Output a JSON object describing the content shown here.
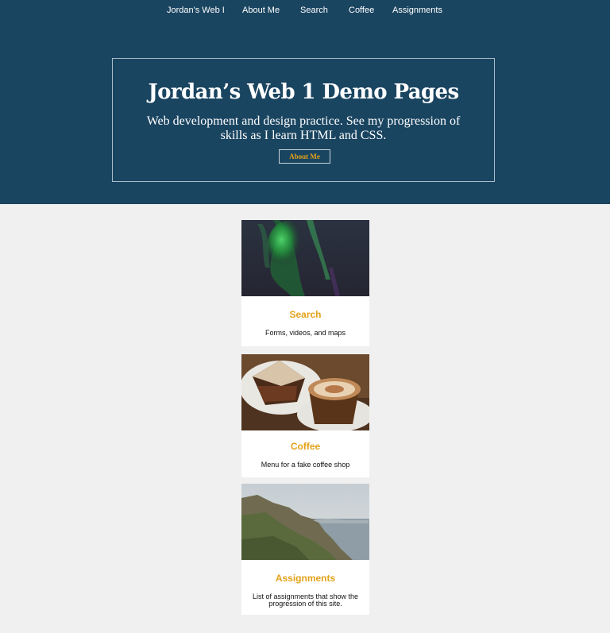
{
  "nav": {
    "items": [
      {
        "label": "Jordan's Web I"
      },
      {
        "label": "About Me"
      },
      {
        "label": "Search"
      },
      {
        "label": "Coffee"
      },
      {
        "label": "Assignments"
      }
    ]
  },
  "hero": {
    "title": "Jordan’s Web 1 Demo Pages",
    "subtitle": "Web development and design practice. See my progression of skills as I learn HTML and CSS.",
    "button_label": "About Me"
  },
  "cards": [
    {
      "title": "Search",
      "description": "Forms, videos, and maps",
      "image": "aurora-borealis-photo"
    },
    {
      "title": "Coffee",
      "description": "Menu for a fake coffee shop",
      "image": "latte-and-cake-photo"
    },
    {
      "title": "Assignments",
      "description": "List of assignments that show the progression of this site.",
      "image": "coastal-cliffs-photo"
    }
  ],
  "colors": {
    "hero_bg": "#1a4561",
    "accent": "#e3a21a",
    "page_bg": "#f0f0f0"
  }
}
